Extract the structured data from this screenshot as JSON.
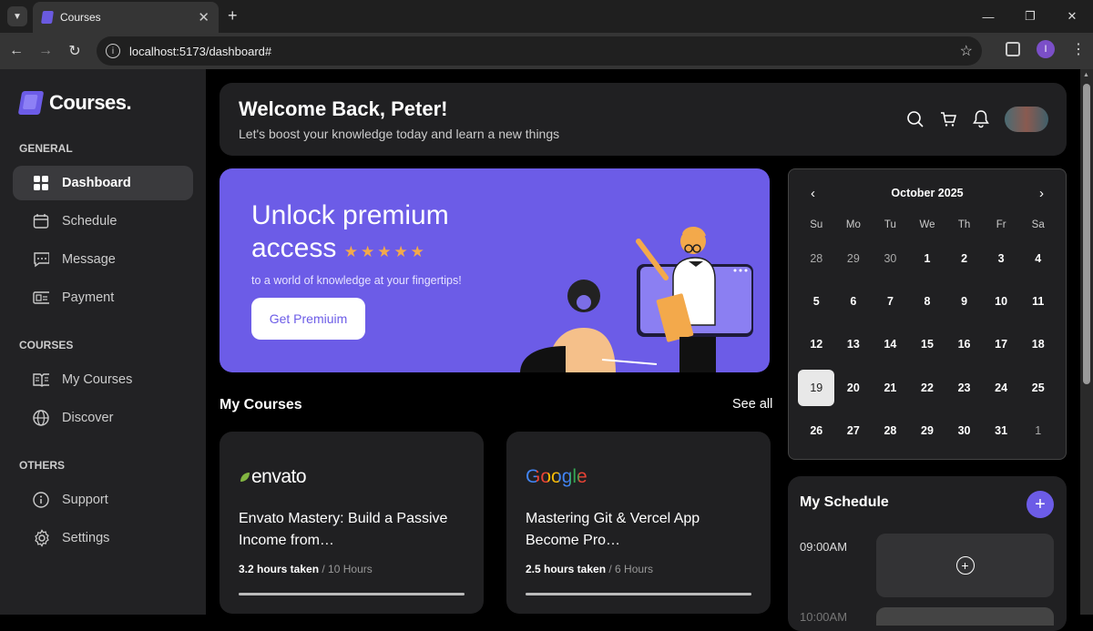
{
  "browser": {
    "tab_title": "Courses",
    "url": "localhost:5173/dashboard#",
    "profile_initial": "I"
  },
  "sidebar": {
    "logo": "Courses.",
    "sections": [
      {
        "title": "GENERAL"
      },
      {
        "title": "COURSES"
      },
      {
        "title": "OTHERS"
      }
    ],
    "items": [
      {
        "label": "Dashboard",
        "icon": "grid-icon",
        "active": true
      },
      {
        "label": "Schedule",
        "icon": "calendar-icon"
      },
      {
        "label": "Message",
        "icon": "message-icon"
      },
      {
        "label": "Payment",
        "icon": "payment-icon"
      },
      {
        "label": "My Courses",
        "icon": "book-open-icon"
      },
      {
        "label": "Discover",
        "icon": "globe-icon"
      },
      {
        "label": "Support",
        "icon": "info-icon"
      },
      {
        "label": "Settings",
        "icon": "gear-icon"
      }
    ]
  },
  "header": {
    "title": "Welcome Back, Peter!",
    "subtitle": "Let's boost your knowledge today and learn a new things"
  },
  "banner": {
    "title_line1": "Unlock premium",
    "title_line2": "access",
    "stars": "★★★★★",
    "subtitle": "to a world of knowledge at your fingertips!",
    "button": "Get Premiuim"
  },
  "courses": {
    "heading": "My Courses",
    "see_all": "See all",
    "items": [
      {
        "brand": "envato",
        "title": "Envato Mastery: Build a Passive Income from…",
        "taken": "3.2 hours taken",
        "total": "/ 10 Hours",
        "progress": 1.0
      },
      {
        "brand": "Google",
        "title": "Mastering Git & Vercel App Become Pro…",
        "taken": "2.5 hours taken",
        "total": "/ 6 Hours",
        "progress": 1.0
      }
    ]
  },
  "calendar": {
    "month": "October 2025",
    "weekdays": [
      "Su",
      "Mo",
      "Tu",
      "We",
      "Th",
      "Fr",
      "Sa"
    ],
    "days": [
      {
        "d": "28",
        "m": true
      },
      {
        "d": "29",
        "m": true
      },
      {
        "d": "30",
        "m": true
      },
      {
        "d": "1"
      },
      {
        "d": "2"
      },
      {
        "d": "3"
      },
      {
        "d": "4"
      },
      {
        "d": "5"
      },
      {
        "d": "6"
      },
      {
        "d": "7"
      },
      {
        "d": "8"
      },
      {
        "d": "9"
      },
      {
        "d": "10"
      },
      {
        "d": "11"
      },
      {
        "d": "12"
      },
      {
        "d": "13"
      },
      {
        "d": "14"
      },
      {
        "d": "15"
      },
      {
        "d": "16"
      },
      {
        "d": "17"
      },
      {
        "d": "18"
      },
      {
        "d": "19",
        "today": true
      },
      {
        "d": "20"
      },
      {
        "d": "21"
      },
      {
        "d": "22"
      },
      {
        "d": "23"
      },
      {
        "d": "24"
      },
      {
        "d": "25"
      },
      {
        "d": "26"
      },
      {
        "d": "27"
      },
      {
        "d": "28"
      },
      {
        "d": "29"
      },
      {
        "d": "30"
      },
      {
        "d": "31"
      },
      {
        "d": "1",
        "m": true
      }
    ]
  },
  "schedule": {
    "title": "My Schedule",
    "time": "09:00AM",
    "time2": "10:00AM"
  },
  "colors": {
    "accent": "#6c5ce7",
    "star": "#f3a94b"
  }
}
